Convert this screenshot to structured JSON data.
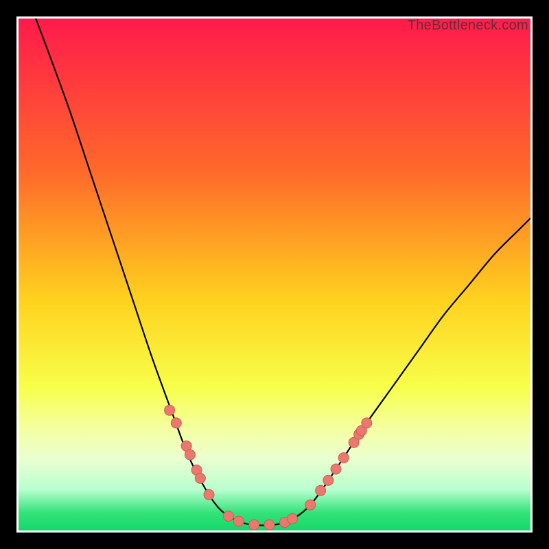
{
  "watermark": "TheBottleneck.com",
  "chart_data": {
    "type": "line",
    "title": "",
    "xlabel": "",
    "ylabel": "",
    "xlim": [
      0,
      100
    ],
    "ylim": [
      0,
      100
    ],
    "gradient_stops": [
      {
        "offset": 0,
        "color": "#ff1a4b"
      },
      {
        "offset": 0.3,
        "color": "#ff6a2a"
      },
      {
        "offset": 0.55,
        "color": "#ffd21e"
      },
      {
        "offset": 0.72,
        "color": "#f7ff4a"
      },
      {
        "offset": 0.8,
        "color": "#f4ffa0"
      },
      {
        "offset": 0.86,
        "color": "#eaffd0"
      },
      {
        "offset": 0.92,
        "color": "#b8ffcf"
      },
      {
        "offset": 0.965,
        "color": "#34e37a"
      },
      {
        "offset": 1.0,
        "color": "#14d86a"
      }
    ],
    "series": [
      {
        "name": "curve",
        "points": [
          {
            "x": 3,
            "y": 101
          },
          {
            "x": 6,
            "y": 93
          },
          {
            "x": 10,
            "y": 82
          },
          {
            "x": 14,
            "y": 70
          },
          {
            "x": 18,
            "y": 58
          },
          {
            "x": 22,
            "y": 46
          },
          {
            "x": 26,
            "y": 34
          },
          {
            "x": 30,
            "y": 23
          },
          {
            "x": 33,
            "y": 15
          },
          {
            "x": 36,
            "y": 9
          },
          {
            "x": 39,
            "y": 4.5
          },
          {
            "x": 42,
            "y": 2.2
          },
          {
            "x": 45,
            "y": 1.2
          },
          {
            "x": 48,
            "y": 1.0
          },
          {
            "x": 51,
            "y": 1.3
          },
          {
            "x": 54,
            "y": 2.5
          },
          {
            "x": 57,
            "y": 5
          },
          {
            "x": 60,
            "y": 9
          },
          {
            "x": 64,
            "y": 15
          },
          {
            "x": 68,
            "y": 21
          },
          {
            "x": 73,
            "y": 28
          },
          {
            "x": 78,
            "y": 35
          },
          {
            "x": 83,
            "y": 42
          },
          {
            "x": 88,
            "y": 48
          },
          {
            "x": 93,
            "y": 54
          },
          {
            "x": 98,
            "y": 59
          },
          {
            "x": 101,
            "y": 62
          }
        ]
      },
      {
        "name": "markers",
        "points": [
          {
            "x": 29.5,
            "y": 23.5
          },
          {
            "x": 30.8,
            "y": 21.0
          },
          {
            "x": 32.8,
            "y": 16.5
          },
          {
            "x": 33.5,
            "y": 14.8
          },
          {
            "x": 34.8,
            "y": 11.8
          },
          {
            "x": 35.5,
            "y": 10.2
          },
          {
            "x": 37.2,
            "y": 7.0
          },
          {
            "x": 41.0,
            "y": 2.8
          },
          {
            "x": 43.0,
            "y": 1.8
          },
          {
            "x": 46.0,
            "y": 1.1
          },
          {
            "x": 49.0,
            "y": 1.1
          },
          {
            "x": 52.0,
            "y": 1.6
          },
          {
            "x": 53.5,
            "y": 2.3
          },
          {
            "x": 57.0,
            "y": 5.0
          },
          {
            "x": 59.0,
            "y": 7.8
          },
          {
            "x": 60.5,
            "y": 9.8
          },
          {
            "x": 62.0,
            "y": 12.0
          },
          {
            "x": 63.5,
            "y": 14.2
          },
          {
            "x": 65.5,
            "y": 17.2
          },
          {
            "x": 66.5,
            "y": 18.8
          },
          {
            "x": 67.0,
            "y": 19.5
          },
          {
            "x": 68.0,
            "y": 21.0
          }
        ]
      }
    ],
    "marker_style": {
      "r": 7.5,
      "fill": "#e9796e",
      "stroke": "#d55a50"
    }
  }
}
